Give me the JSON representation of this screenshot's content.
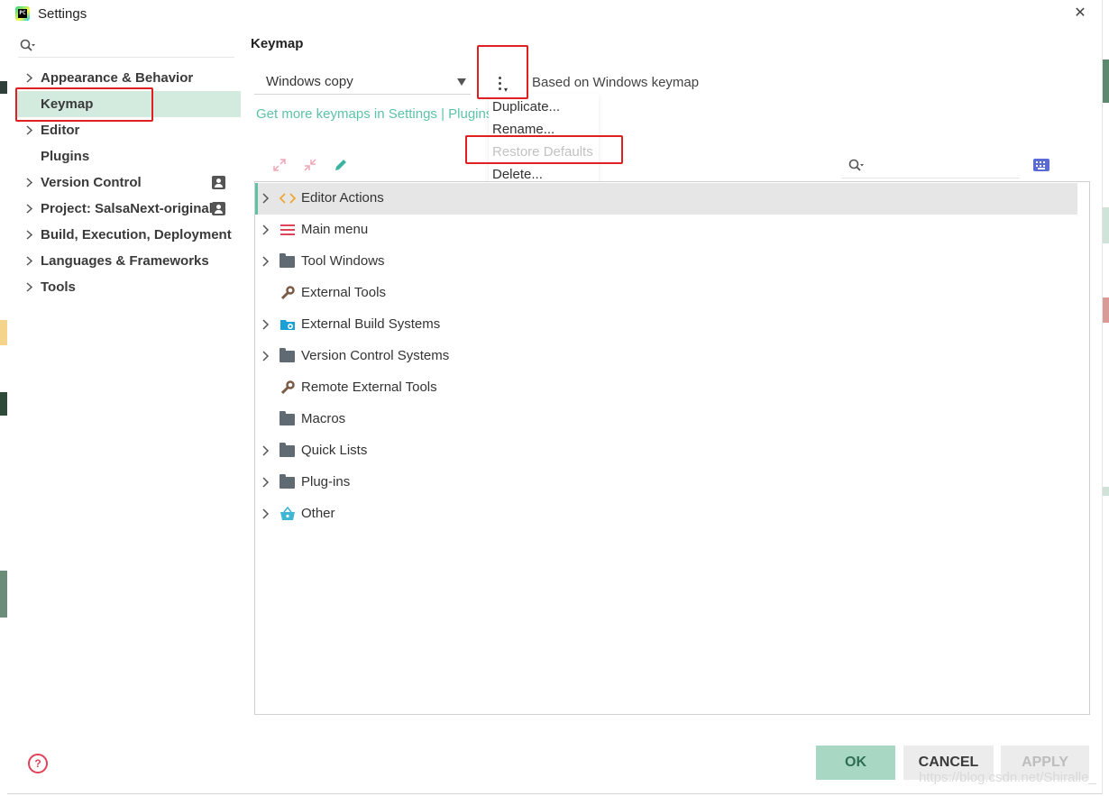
{
  "window": {
    "title": "Settings",
    "logo_text": "PC"
  },
  "sidebar": {
    "search_placeholder": "",
    "items": [
      {
        "label": "Appearance & Behavior",
        "expandable": true
      },
      {
        "label": "Keymap",
        "expandable": false,
        "selected": true
      },
      {
        "label": "Editor",
        "expandable": true
      },
      {
        "label": "Plugins",
        "expandable": false
      },
      {
        "label": "Version Control",
        "expandable": true,
        "badge": "profile-icon"
      },
      {
        "label": "Project: SalsaNext-original",
        "expandable": true,
        "badge": "profile-icon"
      },
      {
        "label": "Build, Execution, Deployment",
        "expandable": true
      },
      {
        "label": "Languages & Frameworks",
        "expandable": true
      },
      {
        "label": "Tools",
        "expandable": true
      }
    ],
    "help_glyph": "?"
  },
  "main": {
    "title": "Keymap",
    "keymap_select": {
      "value": "Windows copy"
    },
    "based_on": "Based on Windows keymap",
    "get_more_link": "Get more keymaps in Settings | Plugins",
    "menu": {
      "items": [
        {
          "label": "Duplicate...",
          "enabled": true
        },
        {
          "label": "Rename...",
          "enabled": true
        },
        {
          "label": "Restore Defaults",
          "enabled": false
        },
        {
          "label": "Delete...",
          "enabled": true
        }
      ]
    },
    "toolbar_icons": [
      "expand-all-icon",
      "collapse-all-icon",
      "edit-pencil-icon"
    ],
    "search_placeholder": "",
    "tree": [
      {
        "label": "Editor Actions",
        "icon": "code-brackets-icon",
        "expandable": true,
        "selected": true
      },
      {
        "label": "Main menu",
        "icon": "menu-icon",
        "expandable": true
      },
      {
        "label": "Tool Windows",
        "icon": "folder-icon",
        "expandable": true
      },
      {
        "label": "External Tools",
        "icon": "wrench-icon",
        "expandable": false
      },
      {
        "label": "External Build Systems",
        "icon": "build-folder-icon",
        "expandable": true
      },
      {
        "label": "Version Control Systems",
        "icon": "folder-icon",
        "expandable": true
      },
      {
        "label": "Remote External Tools",
        "icon": "wrench-icon",
        "expandable": false
      },
      {
        "label": "Macros",
        "icon": "folder-icon",
        "expandable": false
      },
      {
        "label": "Quick Lists",
        "icon": "folder-icon",
        "expandable": true
      },
      {
        "label": "Plug-ins",
        "icon": "folder-icon",
        "expandable": true
      },
      {
        "label": "Other",
        "icon": "basket-icon",
        "expandable": true
      }
    ]
  },
  "footer": {
    "ok": "OK",
    "cancel": "CANCEL",
    "apply": "APPLY",
    "watermark": "https://blog.csdn.net/Shiralle_"
  },
  "colors": {
    "accent": "#5cc3a9",
    "selected_bg": "#d3eadf",
    "highlight_red": "#e02020",
    "ok_bg": "#a8d8c3"
  }
}
